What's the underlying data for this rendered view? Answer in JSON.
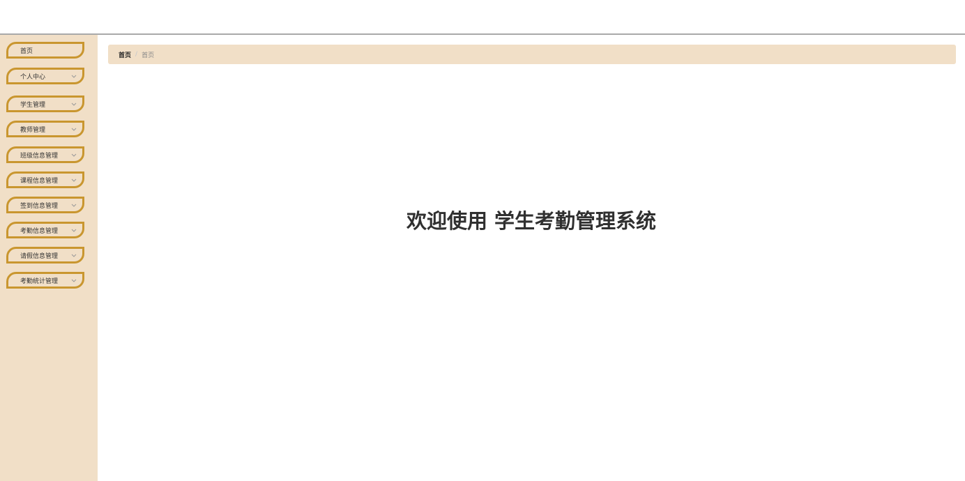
{
  "sidebar": {
    "items": [
      {
        "label": "首页",
        "has_submenu": false
      },
      {
        "label": "个人中心",
        "has_submenu": true
      },
      {
        "label": "学生管理",
        "has_submenu": true
      },
      {
        "label": "教师管理",
        "has_submenu": true
      },
      {
        "label": "班级信息管理",
        "has_submenu": true
      },
      {
        "label": "课程信息管理",
        "has_submenu": true
      },
      {
        "label": "签到信息管理",
        "has_submenu": true
      },
      {
        "label": "考勤信息管理",
        "has_submenu": true
      },
      {
        "label": "请假信息管理",
        "has_submenu": true
      },
      {
        "label": "考勤统计管理",
        "has_submenu": true
      }
    ]
  },
  "breadcrumb": {
    "home": "首页",
    "separator": "/",
    "current": "首页"
  },
  "main": {
    "welcome": "欢迎使用 学生考勤管理系统"
  },
  "colors": {
    "sidebar_bg": "#f1dfc7",
    "menu_border": "#c9962f",
    "breadcrumb_bg": "#f1dfc7"
  },
  "icons": {
    "submenu": "chevron-down-icon"
  }
}
